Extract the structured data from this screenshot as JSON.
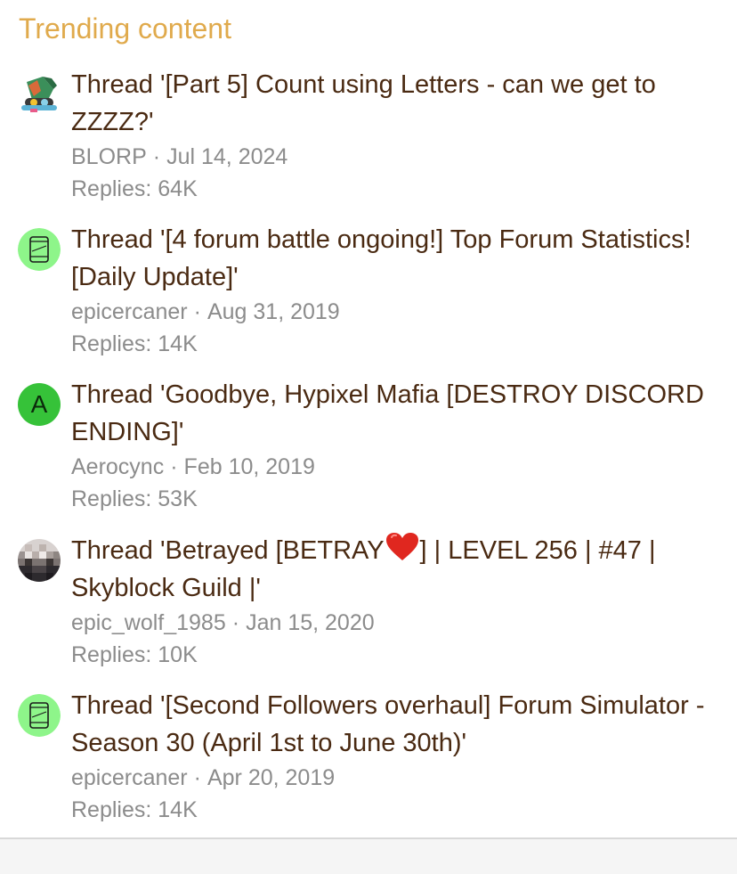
{
  "section": {
    "title": "Trending content"
  },
  "threads": [
    {
      "title": "Thread '[Part 5] Count using Letters - can we get to ZZZZ?'",
      "author": "BLORP",
      "date": "Jul 14, 2024",
      "replies": "Replies: 64K",
      "avatar": "avatar-image-character"
    },
    {
      "title": "Thread '[4 forum battle ongoing!] Top Forum Statistics! [Daily Update]'",
      "author": "epicercaner",
      "date": "Aug 31, 2019",
      "replies": "Replies: 14K",
      "avatar": "avatar-image-green-cup"
    },
    {
      "title": "Thread 'Goodbye, Hypixel Mafia [DESTROY DISCORD ENDING]'",
      "author": "Aerocync",
      "date": "Feb 10, 2019",
      "replies": "Replies: 53K",
      "avatar_letter": "A",
      "avatar_color": "#36c239"
    },
    {
      "title_before": "Thread 'Betrayed [BETRAY",
      "title_after": "] | LEVEL 256 | #47 | Skyblock Guild |'",
      "author": "epic_wolf_1985",
      "date": "Jan 15, 2020",
      "replies": "Replies: 10K",
      "avatar": "avatar-image-pixel-face"
    },
    {
      "title": "Thread '[Second Followers overhaul] Forum Simulator - Season 30 (April 1st to June 30th)'",
      "author": "epicercaner",
      "date": "Apr 20, 2019",
      "replies": "Replies: 14K",
      "avatar": "avatar-image-green-cup"
    }
  ],
  "colors": {
    "title_accent": "#e0aa4c",
    "thread_link": "#4a2a12",
    "meta_text": "#8c8c8c"
  },
  "separator": "·"
}
